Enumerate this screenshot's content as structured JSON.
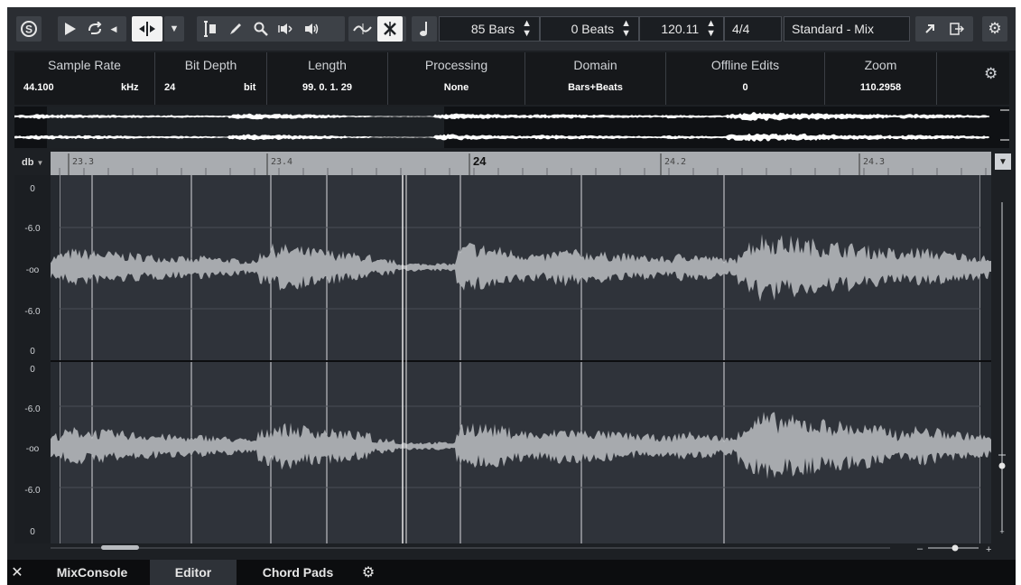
{
  "toolbar": {
    "solo_icon": "s-circle-icon",
    "bars_field": "85 Bars",
    "beats_field": "0 Beats",
    "tempo_field": "120.11",
    "signature_field": "4/4",
    "preset_field": "Standard - Mix"
  },
  "infoline": {
    "cells": [
      {
        "label": "Sample Rate",
        "value": "44.100",
        "unit": "kHz"
      },
      {
        "label": "Bit Depth",
        "value": "24",
        "unit": "bit"
      },
      {
        "label": "Length",
        "value": "99. 0. 1. 29"
      },
      {
        "label": "Processing",
        "value": "None"
      },
      {
        "label": "Domain",
        "value": "Bars+Beats"
      },
      {
        "label": "Offline Edits",
        "value": "0"
      },
      {
        "label": "Zoom",
        "value": "110.2958"
      }
    ]
  },
  "ruler": {
    "scale_label": "db",
    "ticks": [
      "23.3",
      "23.4",
      "24",
      "24.2",
      "24.3"
    ]
  },
  "db_scale": {
    "top_channel": [
      "0",
      "-6.0",
      "-oo",
      "-6.0",
      "0"
    ],
    "bottom_channel": [
      "0",
      "-6.0",
      "-oo",
      "-6.0",
      "0"
    ]
  },
  "tabs": [
    {
      "label": "MixConsole"
    },
    {
      "label": "Editor"
    },
    {
      "label": "Chord Pads"
    }
  ],
  "colors": {
    "background": "#1d2024",
    "waveform": "#a7aaae",
    "waveform_overview": "#ffffff",
    "ruler": "#a9acb0",
    "active_tab": "#2e3238"
  }
}
